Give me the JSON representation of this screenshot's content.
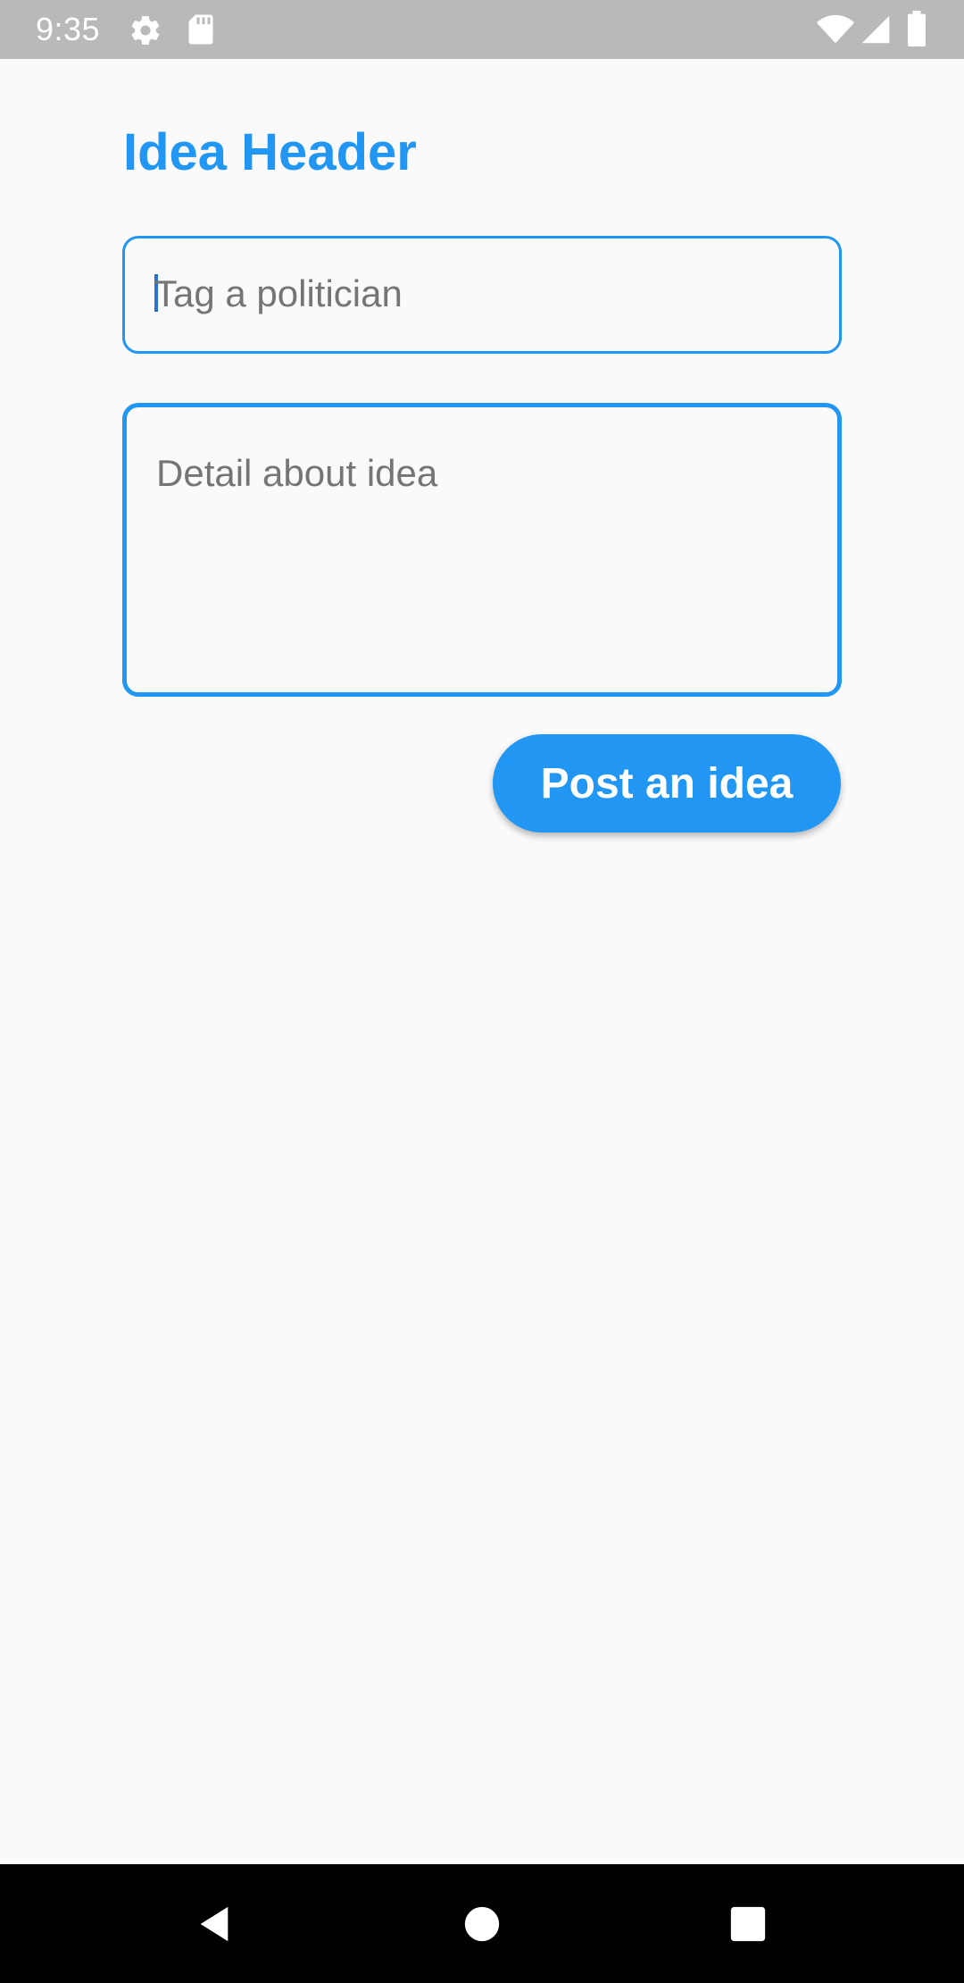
{
  "status_bar": {
    "time": "9:35",
    "icons": [
      "gear-icon",
      "sd-card-icon",
      "wifi-icon",
      "cell-signal-icon",
      "battery-icon"
    ],
    "background": "#b9b9b9"
  },
  "header": {
    "title": "Idea Header"
  },
  "form": {
    "tag_placeholder": "Tag a politician",
    "tag_value": "",
    "detail_placeholder": "Detail about idea",
    "detail_value": ""
  },
  "actions": {
    "post_label": "Post an idea"
  },
  "nav_bar": {
    "buttons": [
      "back-icon",
      "home-icon",
      "recents-icon"
    ]
  },
  "colors": {
    "accent": "#2196f3",
    "background": "#fafafa",
    "placeholder": "#757575",
    "nav_bar": "#000000"
  }
}
